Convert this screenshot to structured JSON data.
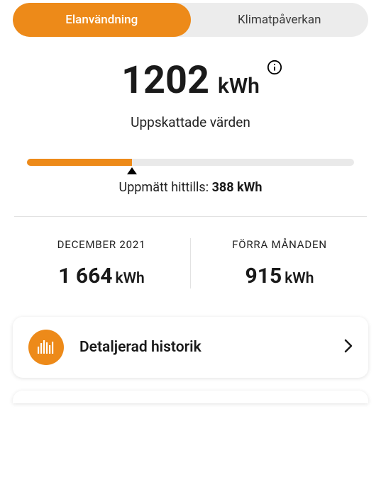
{
  "tabs": {
    "usage": "Elanvändning",
    "climate": "Klimatpåverkan"
  },
  "main": {
    "value": "1202",
    "unit": "kWh",
    "subtitle": "Uppskattade värden"
  },
  "progress": {
    "percent": 32,
    "label": "Uppmätt hittills: ",
    "measured": "388 kWh"
  },
  "compare": {
    "left": {
      "label": "DECEMBER 2021",
      "value": "1 664",
      "unit": "kWh"
    },
    "right": {
      "label": "FÖRRA MÅNADEN",
      "value": "915",
      "unit": "kWh"
    }
  },
  "history_card": {
    "label": "Detaljerad historik"
  }
}
